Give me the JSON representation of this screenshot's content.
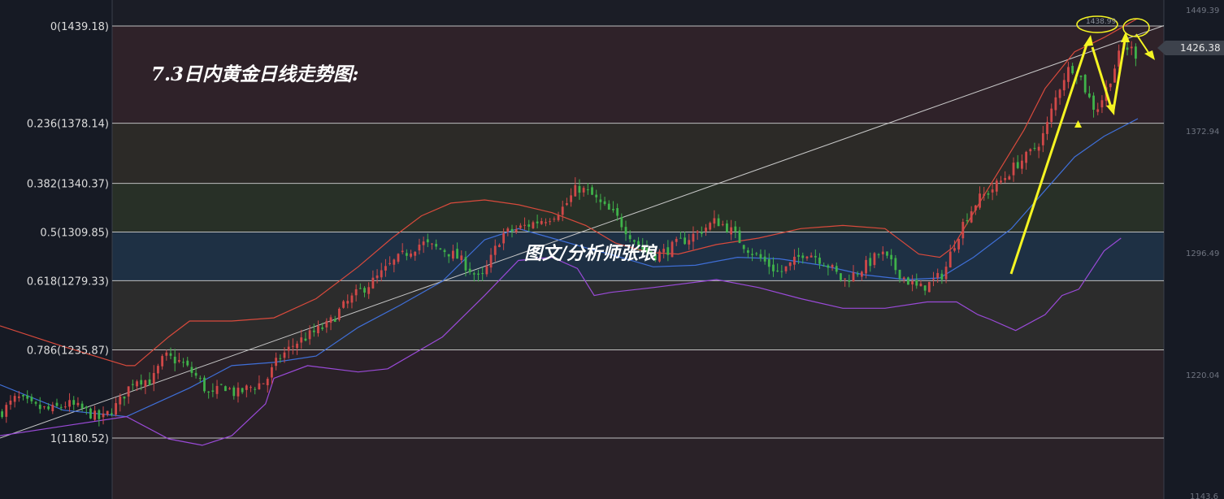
{
  "chart_title": "7.3日内黄金日线走势图:",
  "watermark": "图文/分析师张琅",
  "colors": {
    "background": "#161a24",
    "candle_up": "#d04848",
    "candle_down": "#3fb24a",
    "boll_upper": "#d94a3c",
    "boll_mid": "#3f6fd8",
    "boll_lower": "#9a4ad8",
    "annotation": "#f5f522",
    "trendline": "#c8c8c8",
    "fib_line": "#bfbfbf"
  },
  "price_axis": {
    "tick_labels": [
      "1449.39",
      "1372.94",
      "1296.49",
      "1220.04",
      "1143.6"
    ],
    "current_price_label": "1426.38"
  },
  "fib_levels": [
    {
      "label": "0(1439.18)",
      "price": 1439.18
    },
    {
      "label": "0.236(1378.14)",
      "price": 1378.14
    },
    {
      "label": "0.382(1340.37)",
      "price": 1340.37
    },
    {
      "label": "0.5(1309.85)",
      "price": 1309.85
    },
    {
      "label": "0.618(1279.33)",
      "price": 1279.33
    },
    {
      "label": "0.786(1235.87)",
      "price": 1235.87
    },
    {
      "label": "1(1180.52)",
      "price": 1180.52
    }
  ],
  "annotations": {
    "peak_label": "1438.99"
  },
  "chart_data": {
    "type": "candlestick",
    "title": "7.3日内黄金日线走势图:",
    "ylim": [
      1141,
      1452
    ],
    "y_ticks": [
      1449.39,
      1372.94,
      1296.49,
      1220.04,
      1143.6
    ],
    "current_price": 1426.38,
    "peak": 1438.99,
    "fibonacci": [
      1439.18,
      1378.14,
      1340.37,
      1309.85,
      1279.33,
      1235.87,
      1180.52
    ],
    "close_path": [
      [
        0,
        1196
      ],
      [
        8,
        1206
      ],
      [
        16,
        1200
      ],
      [
        24,
        1198
      ],
      [
        32,
        1202
      ],
      [
        40,
        1198
      ],
      [
        48,
        1192
      ],
      [
        56,
        1202
      ],
      [
        64,
        1218
      ],
      [
        72,
        1216
      ],
      [
        78,
        1232
      ],
      [
        86,
        1228
      ],
      [
        94,
        1218
      ],
      [
        100,
        1206
      ],
      [
        106,
        1214
      ],
      [
        112,
        1208
      ],
      [
        118,
        1212
      ],
      [
        126,
        1216
      ],
      [
        132,
        1230
      ],
      [
        140,
        1240
      ],
      [
        148,
        1246
      ],
      [
        156,
        1252
      ],
      [
        162,
        1262
      ],
      [
        170,
        1272
      ],
      [
        178,
        1280
      ],
      [
        186,
        1290
      ],
      [
        194,
        1298
      ],
      [
        200,
        1303
      ],
      [
        206,
        1300
      ],
      [
        212,
        1298
      ],
      [
        218,
        1293
      ],
      [
        224,
        1285
      ],
      [
        228,
        1279
      ],
      [
        232,
        1290
      ],
      [
        238,
        1308
      ],
      [
        246,
        1312
      ],
      [
        254,
        1316
      ],
      [
        262,
        1320
      ],
      [
        268,
        1326
      ],
      [
        274,
        1338
      ],
      [
        280,
        1334
      ],
      [
        286,
        1326
      ],
      [
        292,
        1320
      ],
      [
        298,
        1310
      ],
      [
        304,
        1300
      ],
      [
        310,
        1295
      ],
      [
        316,
        1298
      ],
      [
        322,
        1303
      ],
      [
        328,
        1307
      ],
      [
        334,
        1312
      ],
      [
        340,
        1317
      ],
      [
        346,
        1312
      ],
      [
        352,
        1303
      ],
      [
        358,
        1296
      ],
      [
        364,
        1290
      ],
      [
        370,
        1284
      ],
      [
        376,
        1290
      ],
      [
        382,
        1298
      ],
      [
        388,
        1294
      ],
      [
        394,
        1288
      ],
      [
        400,
        1279
      ],
      [
        406,
        1284
      ],
      [
        412,
        1290
      ],
      [
        418,
        1297
      ],
      [
        424,
        1288
      ],
      [
        430,
        1280
      ],
      [
        436,
        1274
      ],
      [
        442,
        1278
      ],
      [
        448,
        1284
      ],
      [
        452,
        1300
      ],
      [
        458,
        1318
      ],
      [
        464,
        1330
      ],
      [
        470,
        1336
      ],
      [
        476,
        1343
      ],
      [
        482,
        1352
      ],
      [
        488,
        1358
      ],
      [
        492,
        1364
      ],
      [
        496,
        1373
      ],
      [
        500,
        1390
      ],
      [
        504,
        1405
      ],
      [
        508,
        1414
      ],
      [
        512,
        1410
      ],
      [
        516,
        1396
      ],
      [
        520,
        1386
      ],
      [
        524,
        1396
      ],
      [
        528,
        1410
      ],
      [
        532,
        1424
      ],
      [
        536,
        1426
      ],
      [
        540,
        1420
      ]
    ],
    "bollinger": {
      "upper": [
        [
          0,
          1251
        ],
        [
          30,
          1238
        ],
        [
          60,
          1226
        ],
        [
          64,
          1226
        ],
        [
          80,
          1244
        ],
        [
          90,
          1254
        ],
        [
          110,
          1254
        ],
        [
          130,
          1256
        ],
        [
          150,
          1268
        ],
        [
          170,
          1288
        ],
        [
          186,
          1306
        ],
        [
          200,
          1320
        ],
        [
          214,
          1328
        ],
        [
          230,
          1330
        ],
        [
          246,
          1327
        ],
        [
          262,
          1322
        ],
        [
          278,
          1314
        ],
        [
          292,
          1303
        ],
        [
          308,
          1297
        ],
        [
          322,
          1296
        ],
        [
          340,
          1302
        ],
        [
          360,
          1306
        ],
        [
          380,
          1312
        ],
        [
          400,
          1314
        ],
        [
          420,
          1312
        ],
        [
          436,
          1296
        ],
        [
          446,
          1294
        ],
        [
          452,
          1300
        ],
        [
          468,
          1335
        ],
        [
          486,
          1374
        ],
        [
          496,
          1400
        ],
        [
          510,
          1423
        ],
        [
          524,
          1432
        ],
        [
          540,
          1444
        ]
      ],
      "mid": [
        [
          0,
          1214
        ],
        [
          30,
          1198
        ],
        [
          60,
          1194
        ],
        [
          90,
          1212
        ],
        [
          110,
          1226
        ],
        [
          130,
          1228
        ],
        [
          150,
          1232
        ],
        [
          170,
          1250
        ],
        [
          190,
          1264
        ],
        [
          210,
          1279
        ],
        [
          230,
          1305
        ],
        [
          246,
          1312
        ],
        [
          262,
          1306
        ],
        [
          278,
          1300
        ],
        [
          292,
          1295
        ],
        [
          310,
          1288
        ],
        [
          330,
          1289
        ],
        [
          350,
          1294
        ],
        [
          370,
          1293
        ],
        [
          390,
          1289
        ],
        [
          410,
          1283
        ],
        [
          430,
          1280
        ],
        [
          446,
          1281
        ],
        [
          462,
          1294
        ],
        [
          480,
          1312
        ],
        [
          496,
          1336
        ],
        [
          510,
          1357
        ],
        [
          524,
          1370
        ],
        [
          540,
          1381
        ]
      ],
      "lower": [
        [
          0,
          1182
        ],
        [
          30,
          1188
        ],
        [
          60,
          1194
        ],
        [
          80,
          1180
        ],
        [
          96,
          1176
        ],
        [
          110,
          1182
        ],
        [
          126,
          1202
        ],
        [
          130,
          1218
        ],
        [
          146,
          1226
        ],
        [
          170,
          1222
        ],
        [
          184,
          1224
        ],
        [
          210,
          1244
        ],
        [
          230,
          1270
        ],
        [
          246,
          1292
        ],
        [
          262,
          1294
        ],
        [
          274,
          1287
        ],
        [
          282,
          1270
        ],
        [
          290,
          1272
        ],
        [
          310,
          1275
        ],
        [
          340,
          1280
        ],
        [
          360,
          1275
        ],
        [
          380,
          1268
        ],
        [
          400,
          1262
        ],
        [
          420,
          1262
        ],
        [
          440,
          1266
        ],
        [
          454,
          1266
        ],
        [
          464,
          1258
        ],
        [
          470,
          1255
        ],
        [
          482,
          1248
        ],
        [
          496,
          1258
        ],
        [
          504,
          1270
        ],
        [
          512,
          1274
        ],
        [
          524,
          1298
        ],
        [
          532,
          1306
        ]
      ]
    },
    "trendline": [
      [
        0,
        1180.52
      ],
      [
        540,
        1439.18
      ]
    ]
  }
}
